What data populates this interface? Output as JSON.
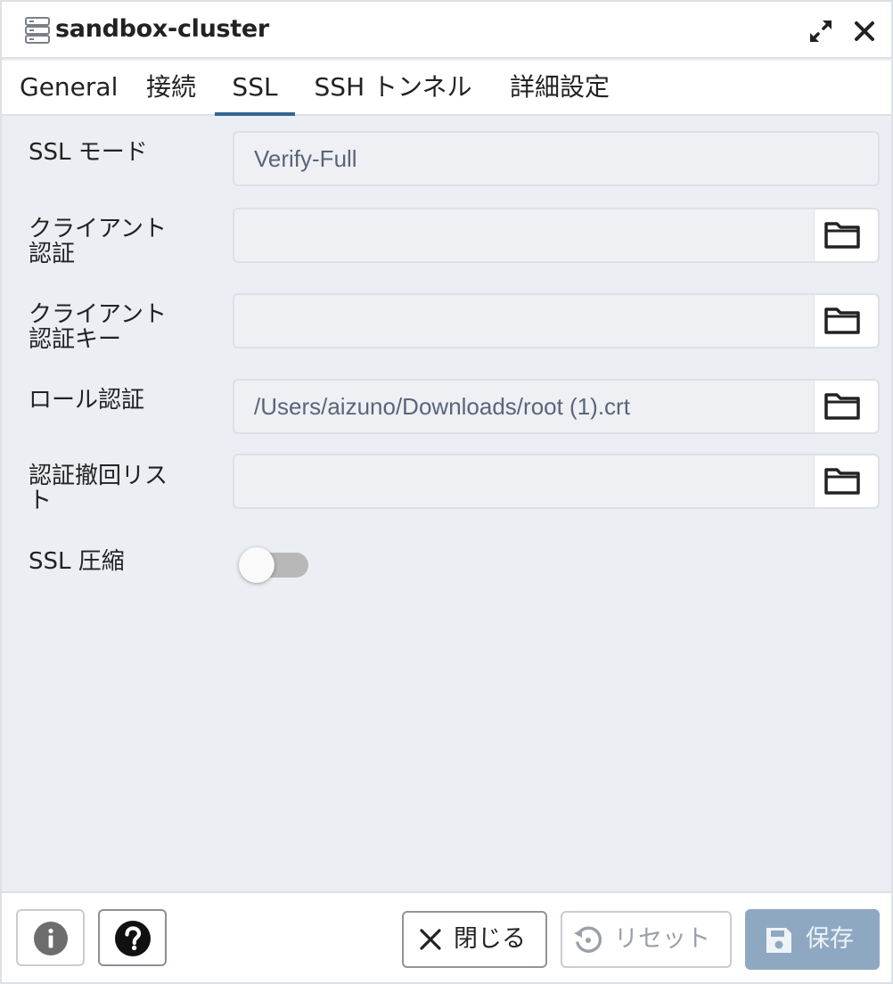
{
  "window": {
    "title": "sandbox-cluster",
    "icon": "server-icon"
  },
  "tabs": [
    {
      "label": "General"
    },
    {
      "label": "接続"
    },
    {
      "label": "SSL",
      "active": true
    },
    {
      "label": "SSH トンネル"
    },
    {
      "label": "詳細設定"
    }
  ],
  "form": {
    "ssl_mode": {
      "label": "SSL モード",
      "value": "Verify-Full"
    },
    "client_cert": {
      "label_line1": "クライアント",
      "label_line2": "認証",
      "value": ""
    },
    "client_cert_key": {
      "label_line1": "クライアント",
      "label_line2": "認証キー",
      "value": ""
    },
    "root_cert": {
      "label": "ロール認証",
      "value": "/Users/aizuno/Downloads/root (1).crt"
    },
    "crl": {
      "label_line1": "認証撤回リス",
      "label_line2": "ト",
      "value": ""
    },
    "ssl_compression": {
      "label": "SSL 圧縮",
      "enabled": false
    }
  },
  "footer": {
    "close_label": "閉じる",
    "reset_label": "リセット",
    "save_label": "保存"
  },
  "colors": {
    "accent": "#326690",
    "save_button": "#8fa8c2",
    "background": "#ebeef3"
  }
}
